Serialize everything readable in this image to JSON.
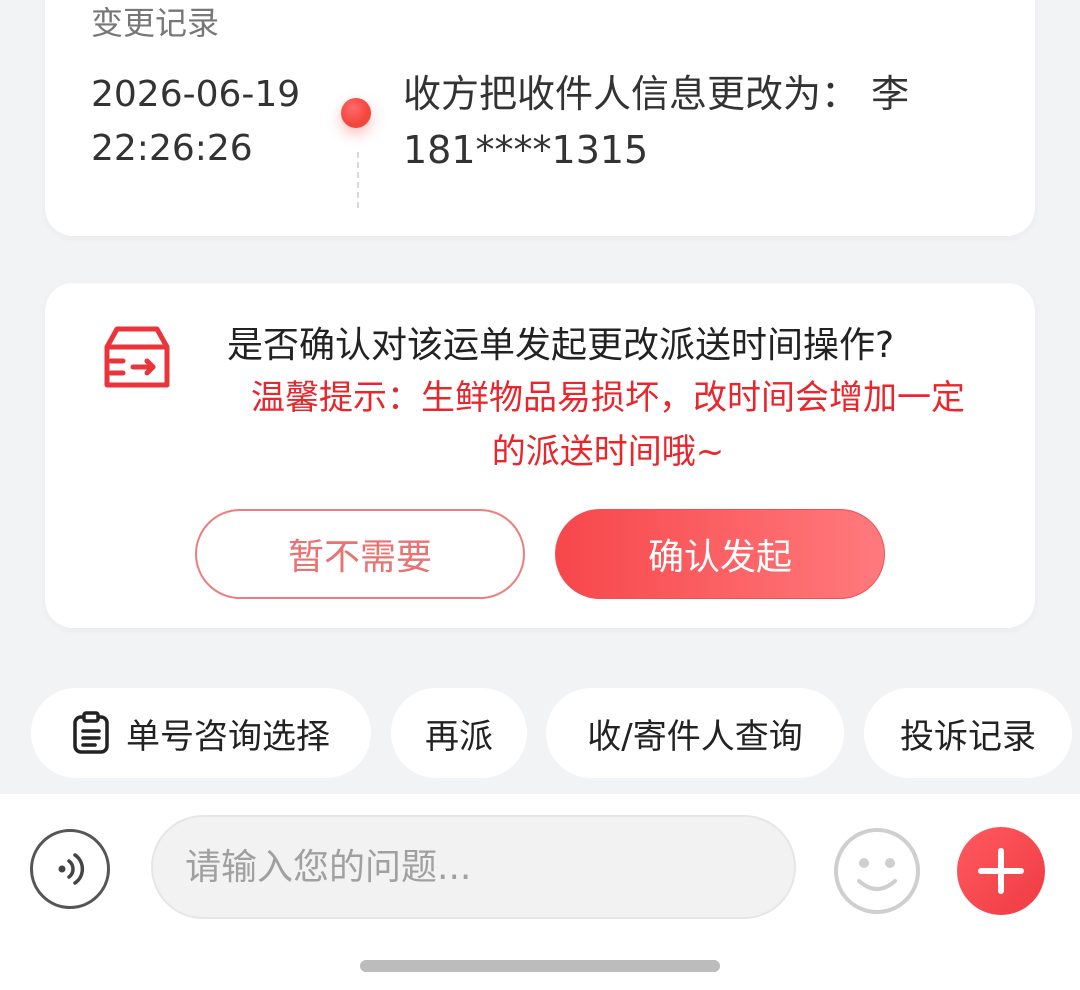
{
  "history": {
    "title": "变更记录",
    "record": {
      "date": "2026-06-19",
      "time": "22:26:26",
      "text_line1": "收方把收件人信息更改为： 李",
      "text_line2": "181****1315"
    }
  },
  "confirm": {
    "icon": "delivery-box-icon",
    "question": "是否确认对该运单发起更改派送时间操作?",
    "tip_line1": "温馨提示：生鲜物品易损坏，改时间会增加一定",
    "tip_line2": "的派送时间哦~",
    "decline_label": "暂不需要",
    "confirm_label": "确认发起"
  },
  "quick_actions": [
    {
      "label": "单号咨询选择",
      "icon": "clipboard-icon"
    },
    {
      "label": "再派"
    },
    {
      "label": "收/寄件人查询"
    },
    {
      "label": "投诉记录"
    }
  ],
  "input_bar": {
    "placeholder": "请输入您的问题...",
    "voice_icon": "voice-icon",
    "emoji_icon": "smiley-icon",
    "plus_icon": "plus-icon"
  },
  "colors": {
    "accent": "#f2454b",
    "tip_red": "#e8262c"
  }
}
